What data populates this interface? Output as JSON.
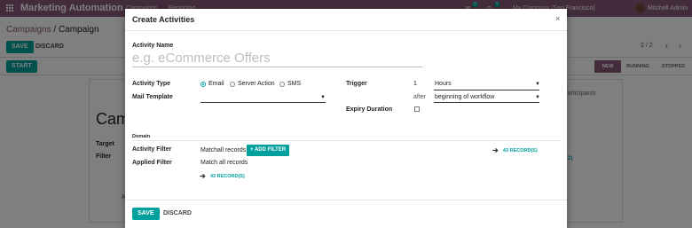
{
  "app": {
    "title": "Marketing Automation",
    "menus": [
      "Campaigns",
      "Reporting"
    ],
    "company": "My Company (San Francisco)",
    "user": "Mitchell Admin",
    "badges": [
      "5",
      "5"
    ]
  },
  "breadcrumb": {
    "parent": "Campaigns",
    "separator": " / ",
    "current": "Campaign"
  },
  "toolbar": {
    "save_label": "SAVE",
    "discard_label": "DISCARD",
    "start_label": "START"
  },
  "pager": {
    "text": "2 / 2",
    "prev": "‹",
    "next": "›"
  },
  "statusbar": {
    "stages": [
      "NEW",
      "RUNNING",
      "STOPPED"
    ],
    "active": "NEW"
  },
  "background_form": {
    "title": "Cam",
    "target_label": "Target",
    "filter_label": "Filter",
    "tab_participants": "Participants",
    "records_link": "2)",
    "letter": "A"
  },
  "modal": {
    "title": "Create Activities",
    "close": "×",
    "activity_name_label": "Activity Name",
    "activity_name_placeholder": "e.g. eCommerce Offers",
    "activity_type_label": "Activity Type",
    "activity_types": [
      "Email",
      "Server Action",
      "SMS"
    ],
    "activity_type_selected": "Email",
    "mail_template_label": "Mail Template",
    "mail_template_value": "",
    "trigger_label": "Trigger",
    "trigger_number": "1",
    "trigger_unit": "Hours",
    "after_label": "after",
    "trigger_type": "beginning of workflow",
    "expiry_label": "Expiry Duration",
    "domain_label": "Domain",
    "activity_filter_label": "Activity Filter",
    "match_prefix": "Match",
    "match_all": "all records",
    "add_filter_label": "+ ADD FILTER",
    "records_count_right": "43 RECORD(S)",
    "applied_filter_label": "Applied Filter",
    "applied_filter_value": "Match all records",
    "records_count_bottom": "43 RECORD(S)",
    "save_label": "SAVE",
    "discard_label": "DISCARD"
  }
}
